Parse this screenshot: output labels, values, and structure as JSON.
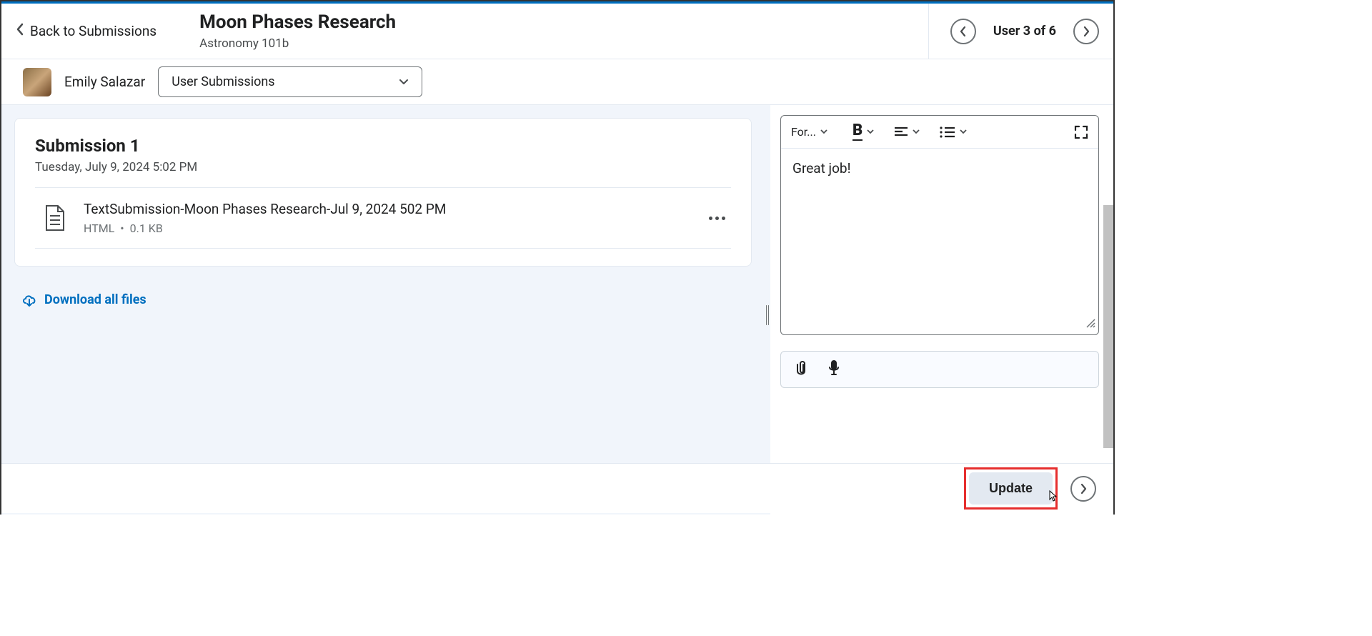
{
  "header": {
    "back_label": "Back to Submissions",
    "assignment_title": "Moon Phases Research",
    "course_name": "Astronomy 101b",
    "user_position": "User 3 of 6"
  },
  "subheader": {
    "student_name": "Emily Salazar",
    "dropdown_label": "User Submissions"
  },
  "submission": {
    "title": "Submission 1",
    "date": "Tuesday, July 9, 2024 5:02 PM",
    "file_name": "TextSubmission-Moon Phases Research-Jul 9, 2024 502 PM",
    "file_type": "HTML",
    "file_size": "0.1 KB"
  },
  "download_label": "Download all files",
  "editor": {
    "format_label": "For...",
    "content": "Great job!"
  },
  "footer": {
    "update_label": "Update"
  }
}
